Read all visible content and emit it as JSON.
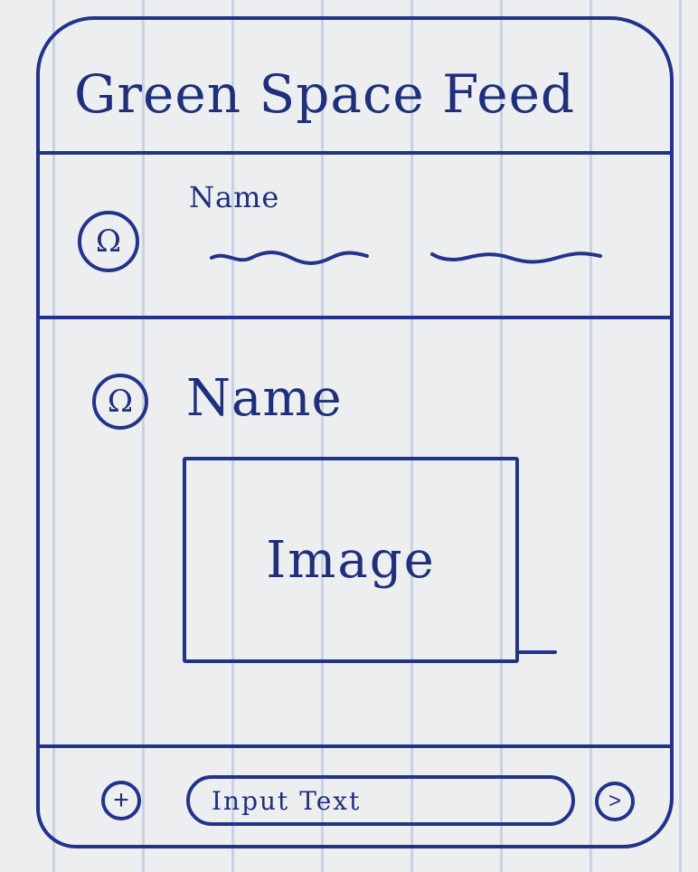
{
  "header": {
    "title": "Green Space Feed"
  },
  "feed": {
    "items": [
      {
        "avatar_glyph": "Ω",
        "name": "Name",
        "content_type": "text-placeholder"
      },
      {
        "avatar_glyph": "Ω",
        "name": "Name",
        "content_type": "image",
        "image_label": "Image"
      }
    ]
  },
  "composer": {
    "add_glyph": "+",
    "input_placeholder": "Input Text",
    "send_glyph": ">"
  },
  "icons": {
    "avatar": "avatar-icon",
    "add": "plus-icon",
    "send": "chevron-right-icon"
  },
  "colors": {
    "ink": "#24338a",
    "paper": "#eceef0"
  }
}
